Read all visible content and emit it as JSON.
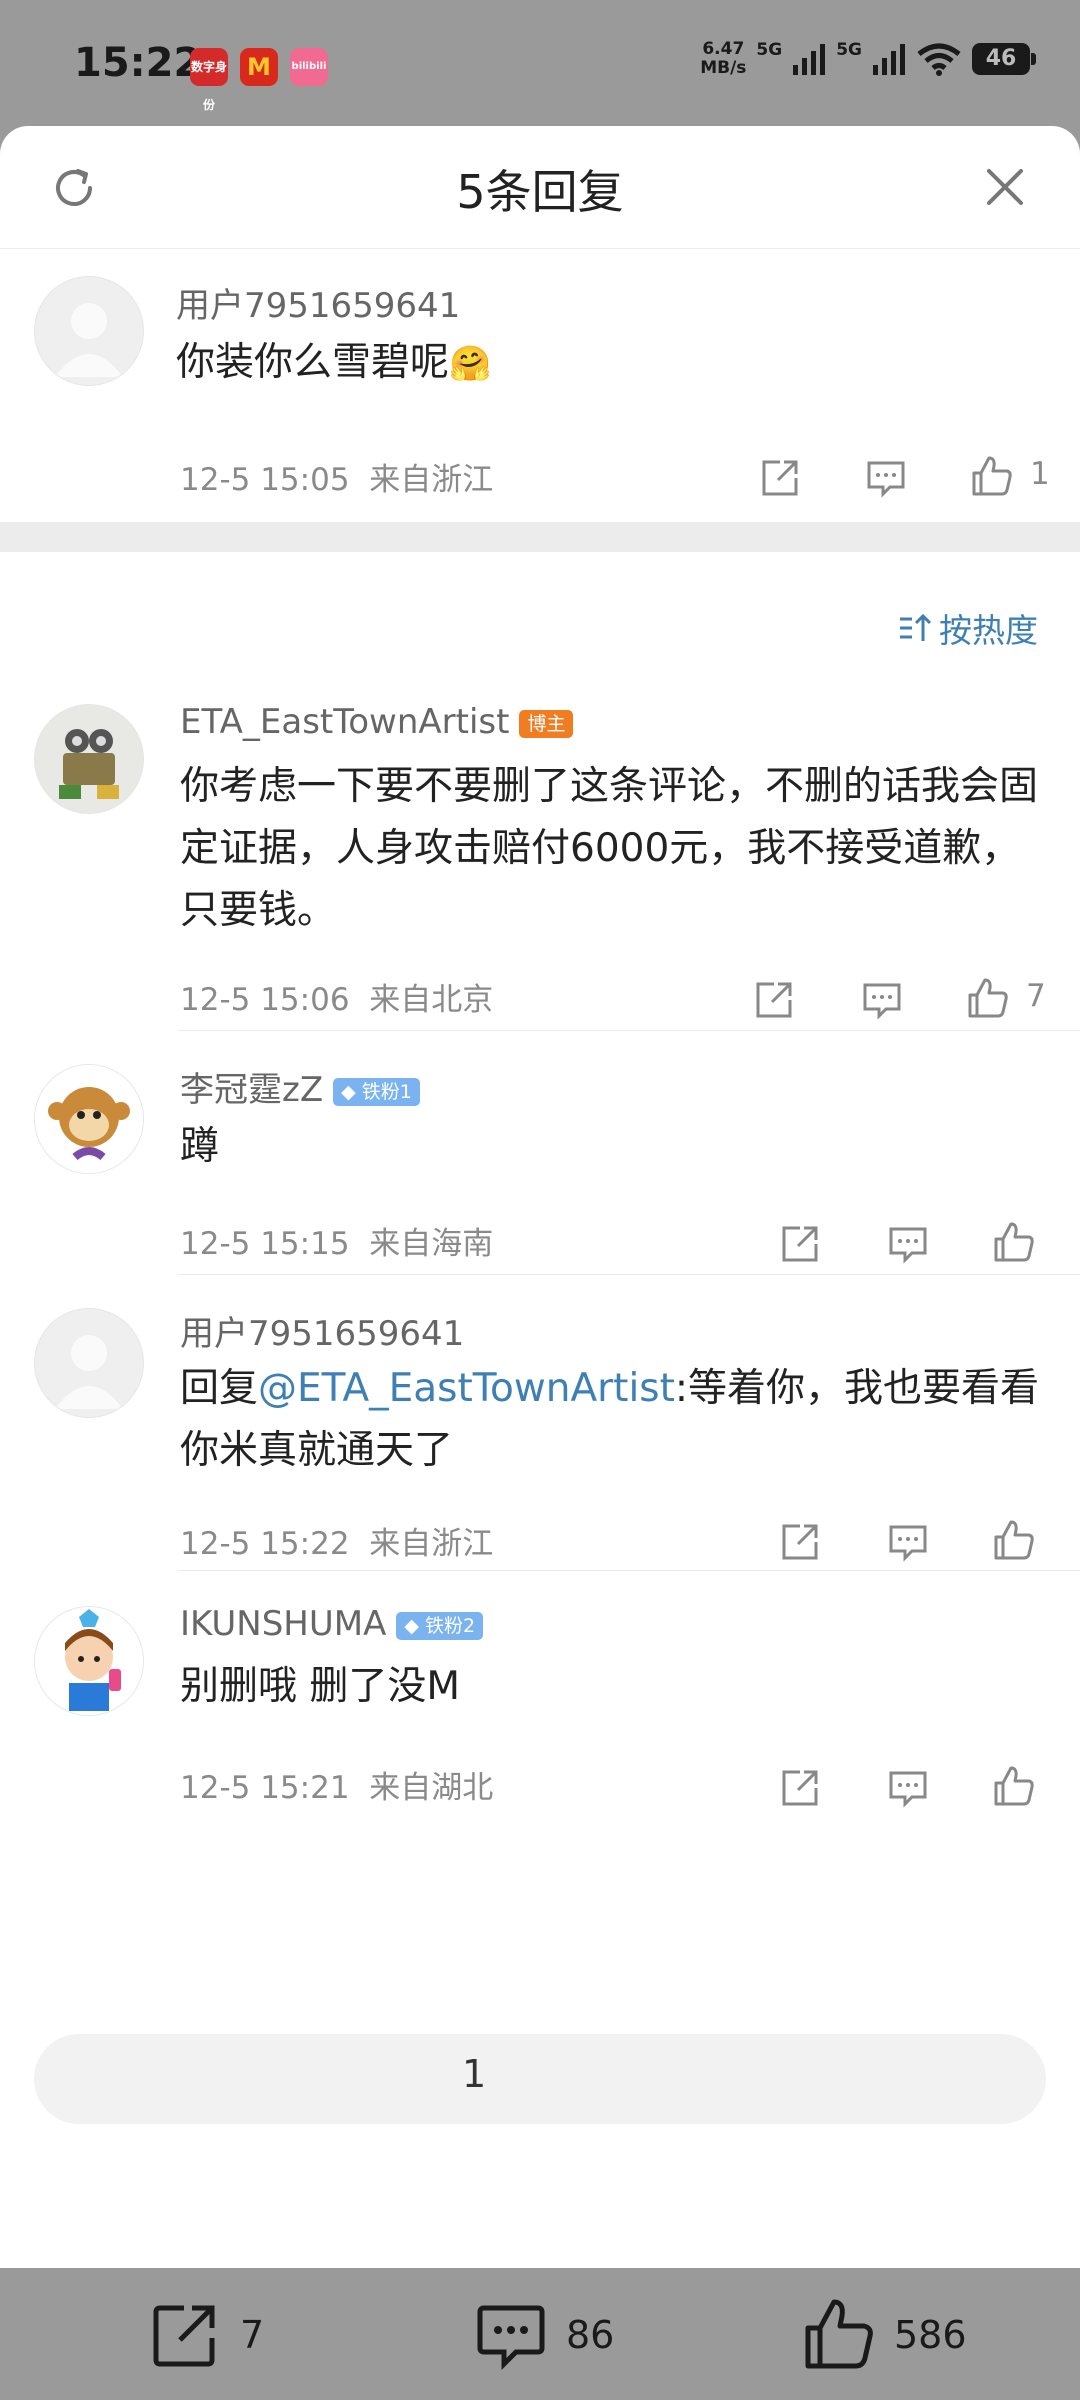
{
  "status_bar": {
    "time": "15:22",
    "apps": [
      {
        "name": "digital-id-app-icon",
        "label": "数字身份",
        "color": "#d42a2a"
      },
      {
        "name": "mcdonalds-app-icon",
        "label": "M",
        "color": "#d9291c"
      },
      {
        "name": "tmall-app-icon",
        "label": "bilibili",
        "color": "#f06a92"
      }
    ],
    "net_speed_value": "6.47",
    "net_speed_unit": "MB/s",
    "signal1_label": "5G",
    "signal2_label": "5G",
    "wifi_label": "7",
    "battery_level": "46"
  },
  "sheet": {
    "title": "5条回复"
  },
  "root_comment": {
    "username": "用户7951659641",
    "text": "你装你么雪碧呢",
    "emoji": "🤗",
    "time": "12-5 15:05",
    "location": "来自浙江",
    "likes": "1"
  },
  "sort_label": "按热度",
  "replies": [
    {
      "username": "ETA_EastTownArtist",
      "badge": "博主",
      "text": "你考虑一下要不要删了这条评论，不删的话我会固定证据，人身攻击赔付6000元，我不接受道歉，只要钱。",
      "time": "12-5 15:06",
      "location": "来自北京",
      "likes": "7"
    },
    {
      "username": "李冠霆zZ",
      "badge": "铁粉1",
      "text": "蹲",
      "time": "12-5 15:15",
      "location": "来自海南",
      "likes": ""
    },
    {
      "username": "用户7951659641",
      "reply_prefix": "回复",
      "mention": "@ETA_EastTownArtist",
      "text": ":等着你，我也要看看你米真就通天了",
      "time": "12-5 15:22",
      "location": "来自浙江",
      "likes": ""
    },
    {
      "username": "IKUNSHUMA",
      "badge": "铁粉2",
      "text": "别删哦 删了没M",
      "time": "12-5 15:21",
      "location": "来自湖北",
      "likes": ""
    }
  ],
  "reply_input": {
    "value": "1"
  },
  "bottom_bar": {
    "share_count": "7",
    "comment_count": "86",
    "like_count": "586"
  },
  "colors": {
    "link": "#3e7fb4",
    "badge_blogger": "#f07d22",
    "badge_fan": "#7ab3f0"
  }
}
